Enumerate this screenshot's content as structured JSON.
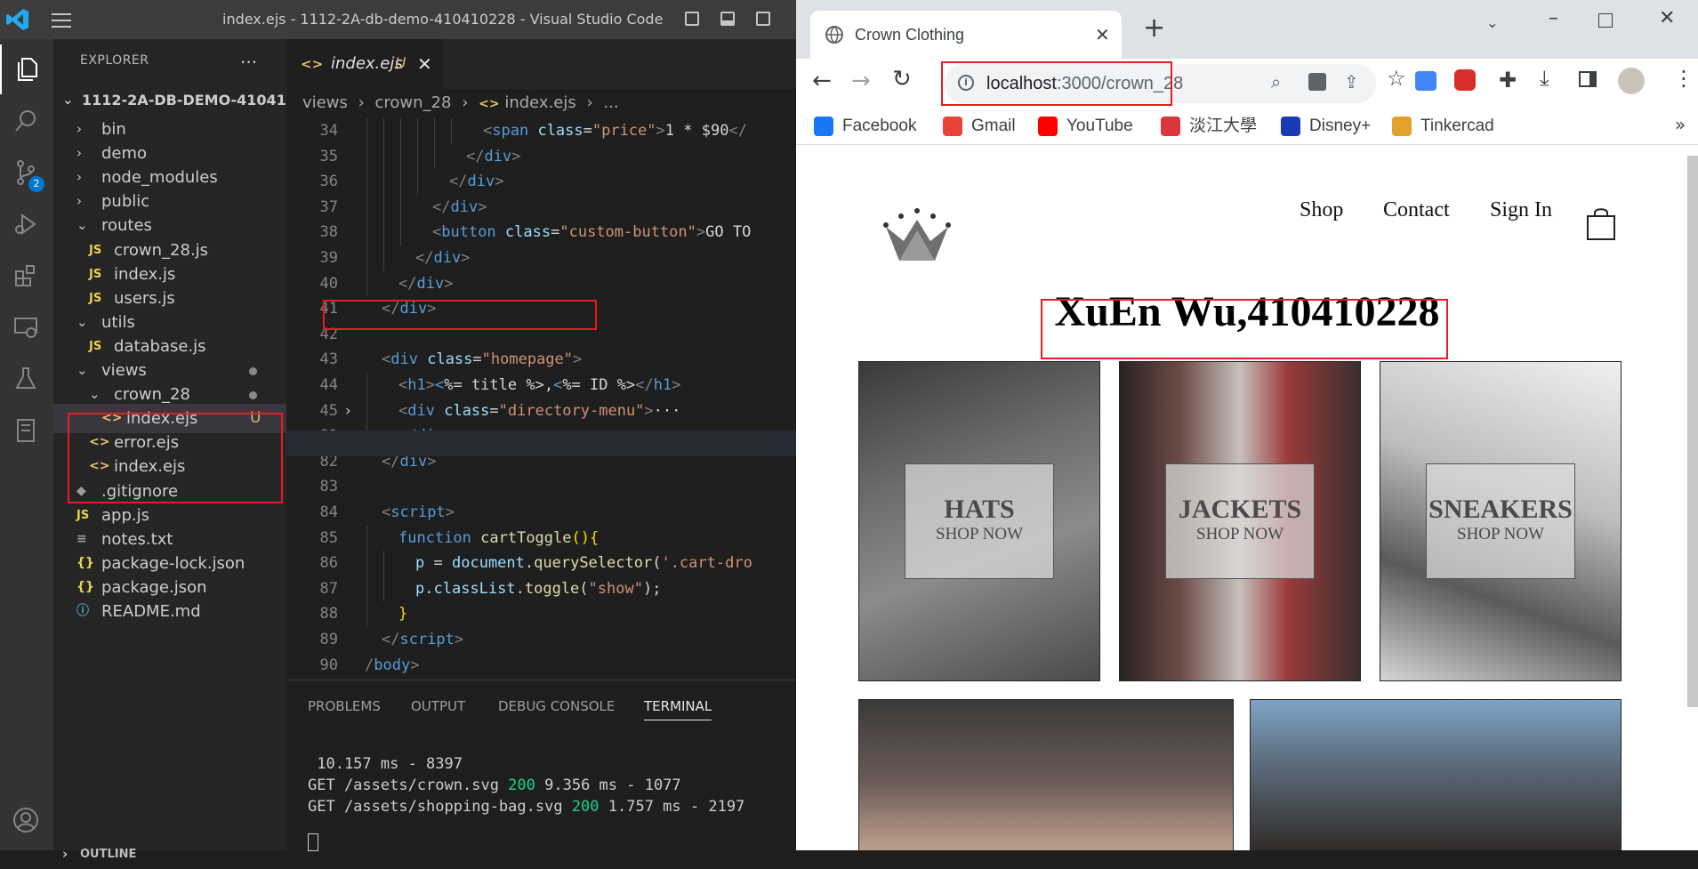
{
  "vscode": {
    "window_title": "index.ejs - 1112-2A-db-demo-410410228 - Visual Studio Code",
    "activity_badge": "2",
    "explorer": {
      "header": "EXPLORER",
      "more": "...",
      "root": "1112-2A-DB-DEMO-41041...",
      "items": [
        {
          "label": "bin",
          "type": "folder"
        },
        {
          "label": "demo",
          "type": "folder"
        },
        {
          "label": "node_modules",
          "type": "folder"
        },
        {
          "label": "public",
          "type": "folder"
        },
        {
          "label": "routes",
          "type": "folder-open"
        },
        {
          "label": "crown_28.js",
          "type": "js"
        },
        {
          "label": "index.js",
          "type": "js"
        },
        {
          "label": "users.js",
          "type": "js"
        },
        {
          "label": "utils",
          "type": "folder-open"
        },
        {
          "label": "database.js",
          "type": "js"
        },
        {
          "label": "views",
          "type": "folder-open"
        },
        {
          "label": "crown_28",
          "type": "folder-open"
        },
        {
          "label": "index.ejs",
          "type": "ejs",
          "badge": "U"
        },
        {
          "label": "error.ejs",
          "type": "ejs"
        },
        {
          "label": "index.ejs",
          "type": "ejs"
        },
        {
          "label": ".gitignore",
          "type": "git"
        },
        {
          "label": "app.js",
          "type": "js"
        },
        {
          "label": "notes.txt",
          "type": "txt"
        },
        {
          "label": "package-lock.json",
          "type": "json"
        },
        {
          "label": "package.json",
          "type": "json"
        },
        {
          "label": "README.md",
          "type": "info"
        }
      ],
      "outline": "OUTLINE"
    },
    "tab": {
      "label": "index.ejs",
      "status": "U",
      "close": "✕"
    },
    "breadcrumb": {
      "p1": "views",
      "p2": "crown_28",
      "p3": "index.ejs",
      "p4": "..."
    },
    "code": [
      {
        "n": "34",
        "html": "<span class='tg'>&lt;</span><span class='tn'>span</span> <span class='at'>class</span><span class='tx'>=</span><span class='st'>\"price\"</span><span class='tg'>&gt;</span><span class='tx'>1 * $90</span><span class='tg'>&lt;/</span>",
        "indent": 6
      },
      {
        "n": "35",
        "html": "<span class='tg'>&lt;/</span><span class='tn'>div</span><span class='tg'>&gt;</span>",
        "indent": 5
      },
      {
        "n": "36",
        "html": "<span class='tg'>&lt;/</span><span class='tn'>div</span><span class='tg'>&gt;</span>",
        "indent": 4
      },
      {
        "n": "37",
        "html": "<span class='tg'>&lt;/</span><span class='tn'>div</span><span class='tg'>&gt;</span>",
        "indent": 3
      },
      {
        "n": "38",
        "html": "<span class='tg'>&lt;</span><span class='tn'>button</span> <span class='at'>class</span><span class='tx'>=</span><span class='st'>\"custom-button\"</span><span class='tg'>&gt;</span><span class='tx'>GO TO</span>",
        "indent": 3
      },
      {
        "n": "39",
        "html": "<span class='tg'>&lt;/</span><span class='tn'>div</span><span class='tg'>&gt;</span>",
        "indent": 2
      },
      {
        "n": "40",
        "html": "<span class='tg'>&lt;/</span><span class='tn'>div</span><span class='tg'>&gt;</span>",
        "indent": 1
      },
      {
        "n": "41",
        "html": "<span class='tg'>&lt;/</span><span class='tn'>div</span><span class='tg'>&gt;</span>",
        "indent": 0
      },
      {
        "n": "42",
        "html": "",
        "indent": 0
      },
      {
        "n": "43",
        "html": "<span class='tg'>&lt;</span><span class='tn'>div</span> <span class='at'>class</span><span class='tx'>=</span><span class='st'>\"homepage\"</span><span class='tg'>&gt;</span>",
        "indent": 0
      },
      {
        "n": "44",
        "html": "<span class='tg'>&lt;</span><span class='tn'>h1</span><span class='tg'>&gt;</span><span class='tn'>&lt;</span><span class='tx'>%= title %&gt;,</span><span class='tn'>&lt;</span><span class='tx'>%= ID %&gt;</span><span class='tg'>&lt;/</span><span class='tn'>h1</span><span class='tg'>&gt;</span>",
        "indent": 1
      },
      {
        "n": "45",
        "html": "<span class='tg'>&lt;</span><span class='tn'>div</span> <span class='at'>class</span><span class='tx'>=</span><span class='st'>\"directory-menu\"</span><span class='tg'>&gt;</span><span class='tx'>···</span>",
        "indent": 1
      },
      {
        "n": "81",
        "html": "<span class='tg'>&lt;/</span><span class='tn'>div</span><span class='tg'>&gt;</span>",
        "indent": 1
      },
      {
        "n": "82",
        "html": "<span class='tg'>&lt;/</span><span class='tn'>div</span><span class='tg'>&gt;</span>",
        "indent": 0
      },
      {
        "n": "83",
        "html": "",
        "indent": 0
      },
      {
        "n": "84",
        "html": "<span class='tg'>&lt;</span><span class='tn'>script</span><span class='tg'>&gt;</span>",
        "indent": 0
      },
      {
        "n": "85",
        "html": "<span class='kw'>function</span> <span class='fn'>cartToggle</span><span class='br'>(){</span>",
        "indent": 1
      },
      {
        "n": "86",
        "html": "<span class='at'>p</span> <span class='tx'>=</span> <span class='at'>document</span><span class='tx'>.</span><span class='fn'>querySelector</span><span class='tx'>(</span><span class='st'>'.cart-dro</span>",
        "indent": 2
      },
      {
        "n": "87",
        "html": "<span class='at'>p</span><span class='tx'>.</span><span class='at'>classList</span><span class='tx'>.</span><span class='fn'>toggle</span><span class='tx'>(</span><span class='st'>\"show\"</span><span class='tx'>);</span>",
        "indent": 2
      },
      {
        "n": "88",
        "html": "<span class='br'>}</span>",
        "indent": 1
      },
      {
        "n": "89",
        "html": "<span class='tg'>&lt;/</span><span class='tn'>script</span><span class='tg'>&gt;</span>",
        "indent": 0
      },
      {
        "n": "90",
        "html": "<span class='tg'>/</span><span class='tn'>body</span><span class='tg'>&gt;</span>",
        "indent": -1
      }
    ],
    "panel": {
      "tabs": [
        "PROBLEMS",
        "OUTPUT",
        "DEBUG CONSOLE",
        "TERMINAL"
      ],
      "active_tab": "TERMINAL",
      "lines": [
        {
          "pre": " 10.157 ms - 8397",
          "status": "",
          "post": ""
        },
        {
          "pre": "GET /assets/crown.svg ",
          "status": "200",
          "post": " 9.356 ms - 1077"
        },
        {
          "pre": "GET /assets/shopping-bag.svg ",
          "status": "200",
          "post": " 1.757 ms - 2197"
        }
      ]
    }
  },
  "chrome": {
    "tab_title": "Crown Clothing",
    "tab_close": "✕",
    "new_tab": "+",
    "url_host": "localhost",
    "url_path": ":3000/crown_28",
    "bookmarks": [
      {
        "label": "Facebook",
        "color": "#1877f2"
      },
      {
        "label": "Gmail",
        "color": "#ea4335"
      },
      {
        "label": "YouTube",
        "color": "#ff0000"
      },
      {
        "label": "淡江大學",
        "color": "#d9363e"
      },
      {
        "label": "Disney+",
        "color": "#1b3bb3"
      },
      {
        "label": "Tinkercad",
        "color": "#e2a12b"
      }
    ],
    "bookmarks_overflow": "»",
    "site": {
      "nav": [
        "Shop",
        "Contact",
        "Sign In"
      ],
      "heading": "XuEn Wu,410410228",
      "categories": [
        {
          "title": "HATS",
          "subtitle": "SHOP NOW"
        },
        {
          "title": "JACKETS",
          "subtitle": "SHOP NOW"
        },
        {
          "title": "SNEAKERS",
          "subtitle": "SHOP NOW"
        }
      ]
    }
  },
  "colors": {
    "highlight": "#e51c23",
    "vscode_accent": "#0078d4"
  }
}
